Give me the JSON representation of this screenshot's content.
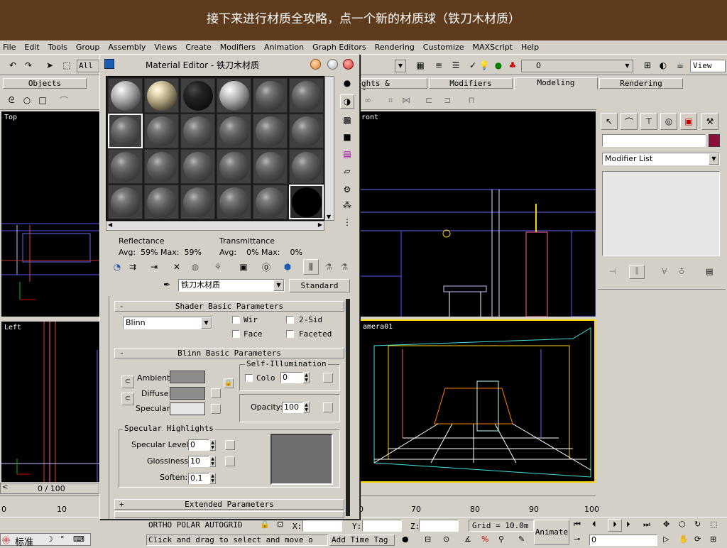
{
  "banner": {
    "caption": "接下来进行材质全攻略，点一个新的材质球（铁刀木材质）"
  },
  "menu": [
    "File",
    "Edit",
    "Tools",
    "Group",
    "Assembly",
    "Views",
    "Create",
    "Modifiers",
    "Animation",
    "Graph Editors",
    "Rendering",
    "Customize",
    "MAXScript",
    "Help"
  ],
  "toolbar": {
    "selection_filter": "All",
    "named_sel": "0",
    "view_dropdown": "View"
  },
  "tabs": [
    "Objects",
    "ghts & Cameras",
    "Modifiers",
    "Modeling",
    "Rendering"
  ],
  "viewports": {
    "top": "Top",
    "front": "ront",
    "left": "Left",
    "camera": "amera01"
  },
  "command_panel": {
    "modifier_list": "Modifier List",
    "accent_color": "#8b0f3a"
  },
  "material_editor": {
    "title": "Material Editor - 铁刀木材质",
    "reflectance_label": "Reflectance",
    "reflectance_values": "Avg:  59% Max:  59%",
    "transmittance_label": "Transmittance",
    "transmittance_values": "Avg:    0% Max:    0%",
    "material_name": "铁刀木材质",
    "material_type": "Standard",
    "shader_rollout": "Shader Basic Parameters",
    "shader_type": "Blinn",
    "wire_label": "Wir",
    "two_sided_label": "2-Sid",
    "face_label": "Face",
    "faceted_label": "Faceted",
    "blinn_rollout": "Blinn Basic Parameters",
    "self_illum_title": "Self-Illumination",
    "color_label": "Colo",
    "self_illum_value": "0",
    "ambient_label": "Ambient:",
    "diffuse_label": "Diffuse:",
    "specular_label": "Specular:",
    "opacity_label": "Opacity:",
    "opacity_value": "100",
    "spec_highlights_title": "Specular Highlights",
    "spec_level_label": "Specular Level:",
    "spec_level_value": "0",
    "glossiness_label": "Glossiness:",
    "glossiness_value": "10",
    "soften_label": "Soften:",
    "soften_value": "0.1",
    "extended_rollout": "Extended Parameters",
    "ambient_color": "#8c8c8c",
    "diffuse_color": "#8c8c8c",
    "specular_color": "#e6e6e6",
    "highlight_preview_color": "#6e6e6e",
    "rollout_plus": "+",
    "rollout_minus": "-"
  },
  "timeline": {
    "frame_counter": "0 / 100",
    "ticks_left": [
      "0",
      "10"
    ],
    "ticks_right": [
      "70",
      "80",
      "90",
      "100"
    ],
    "tick_60_partial": "0"
  },
  "status": {
    "snaps": "ORTHO  POLAR  AUTOGRID",
    "x_label": "X:",
    "y_label": "Y:",
    "z_label": "Z:",
    "grid": "Grid = 10.0m",
    "animate": "Animate",
    "prompt": "Click and drag to select and move o",
    "add_time_tag": "Add Time Tag",
    "ime_label": "标准",
    "frame_field": "0"
  }
}
